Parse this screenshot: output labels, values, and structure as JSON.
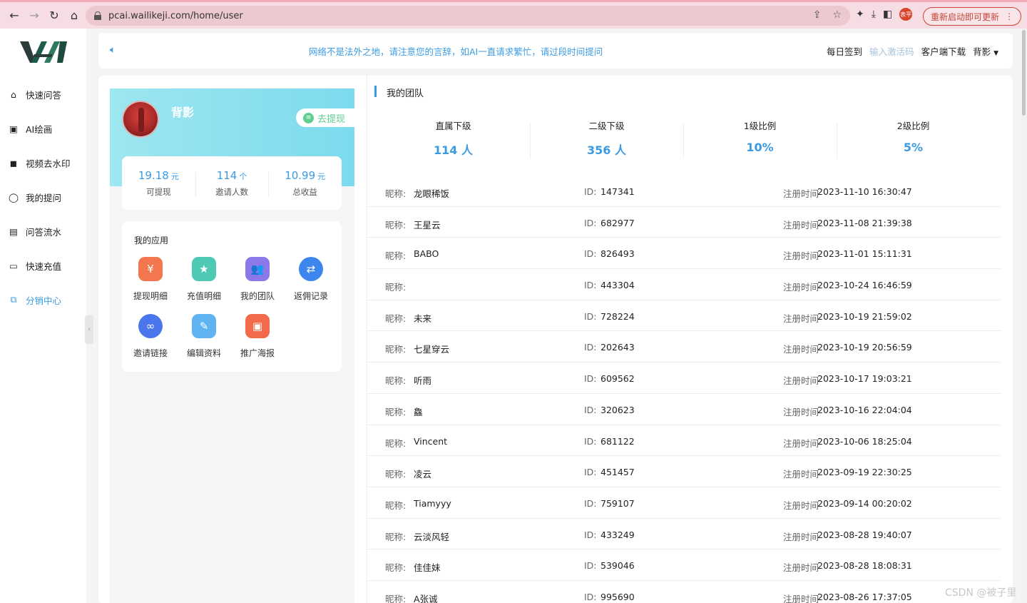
{
  "browser": {
    "url": "pcai.wailikeji.com/home/user",
    "update_button": "重新启动即可更新",
    "profile_badge": "表平"
  },
  "sidebar": {
    "items": [
      {
        "label": "快速问答",
        "icon": "home-icon"
      },
      {
        "label": "AI绘画",
        "icon": "image-icon"
      },
      {
        "label": "视频去水印",
        "icon": "video-camera-icon"
      },
      {
        "label": "我的提问",
        "icon": "chat-bubble-icon"
      },
      {
        "label": "问答流水",
        "icon": "clipboard-icon"
      },
      {
        "label": "快速充值",
        "icon": "credit-card-icon"
      },
      {
        "label": "分销中心",
        "icon": "share-icon",
        "active": true
      }
    ]
  },
  "topbar": {
    "notice": "网络不是法外之地，请注意您的言辞，如AI一直请求繁忙，请过段时间提问",
    "checkin": "每日签到",
    "activation": "输入激活码",
    "client_download": "客户端下载",
    "user_menu": "背影"
  },
  "profile": {
    "username": "背影",
    "withdraw_button": "去提现",
    "stats": [
      {
        "value": "19.18",
        "unit": "元",
        "label": "可提现"
      },
      {
        "value": "114",
        "unit": "个",
        "label": "邀请人数"
      },
      {
        "value": "10.99",
        "unit": "元",
        "label": "总收益"
      }
    ]
  },
  "apps": {
    "title": "我的应用",
    "items": [
      {
        "label": "提现明细",
        "icon": "withdraw-detail-icon",
        "color": "#f2774e",
        "glyph": "¥"
      },
      {
        "label": "充值明细",
        "icon": "recharge-detail-icon",
        "color": "#4ec9b4",
        "glyph": "★"
      },
      {
        "label": "我的团队",
        "icon": "team-icon",
        "color": "#8d78ea",
        "glyph": "👥"
      },
      {
        "label": "返佣记录",
        "icon": "rebate-record-icon",
        "color": "#3d86ee",
        "glyph": "⇄"
      },
      {
        "label": "邀请链接",
        "icon": "link-icon",
        "color": "#4b75ea",
        "glyph": "∞"
      },
      {
        "label": "编辑资料",
        "icon": "edit-profile-icon",
        "color": "#5fb3f0",
        "glyph": "✎"
      },
      {
        "label": "推广海报",
        "icon": "poster-icon",
        "color": "#f26a4a",
        "glyph": "▣"
      }
    ]
  },
  "team": {
    "title": "我的团队",
    "summary": [
      {
        "label": "直属下级",
        "value": "114 人"
      },
      {
        "label": "二级下级",
        "value": "356 人"
      },
      {
        "label": "1级比例",
        "value": "10%"
      },
      {
        "label": "2级比例",
        "value": "5%"
      }
    ],
    "nick_label": "昵称:",
    "id_label": "ID:",
    "reg_label": "注册时间",
    "members": [
      {
        "nick": "龙眼稀饭",
        "id": "147341",
        "reg": "2023-11-10 16:30:47"
      },
      {
        "nick": "王星云",
        "id": "682977",
        "reg": "2023-11-08 21:39:38"
      },
      {
        "nick": "BABO",
        "id": "826493",
        "reg": "2023-11-01 15:11:31"
      },
      {
        "nick": "",
        "id": "443304",
        "reg": "2023-10-24 16:46:59"
      },
      {
        "nick": "未来",
        "id": "728224",
        "reg": "2023-10-19 21:59:02"
      },
      {
        "nick": "七星穿云",
        "id": "202643",
        "reg": "2023-10-19 20:56:59"
      },
      {
        "nick": "听雨",
        "id": "609562",
        "reg": "2023-10-17 19:03:21"
      },
      {
        "nick": "鱻",
        "id": "320623",
        "reg": "2023-10-16 22:04:04"
      },
      {
        "nick": "Vincent",
        "id": "681122",
        "reg": "2023-10-06 18:25:04"
      },
      {
        "nick": "凌云",
        "id": "451457",
        "reg": "2023-09-19 22:30:25"
      },
      {
        "nick": "Tiamyyy",
        "id": "759107",
        "reg": "2023-09-14 00:20:02"
      },
      {
        "nick": "云淡风轻",
        "id": "433249",
        "reg": "2023-08-28 19:40:07"
      },
      {
        "nick": "佳佳妹",
        "id": "539046",
        "reg": "2023-08-28 18:08:31"
      },
      {
        "nick": "A张诚",
        "id": "995690",
        "reg": "2023-08-26 17:37:05"
      }
    ]
  },
  "watermark": "CSDN @被子里"
}
